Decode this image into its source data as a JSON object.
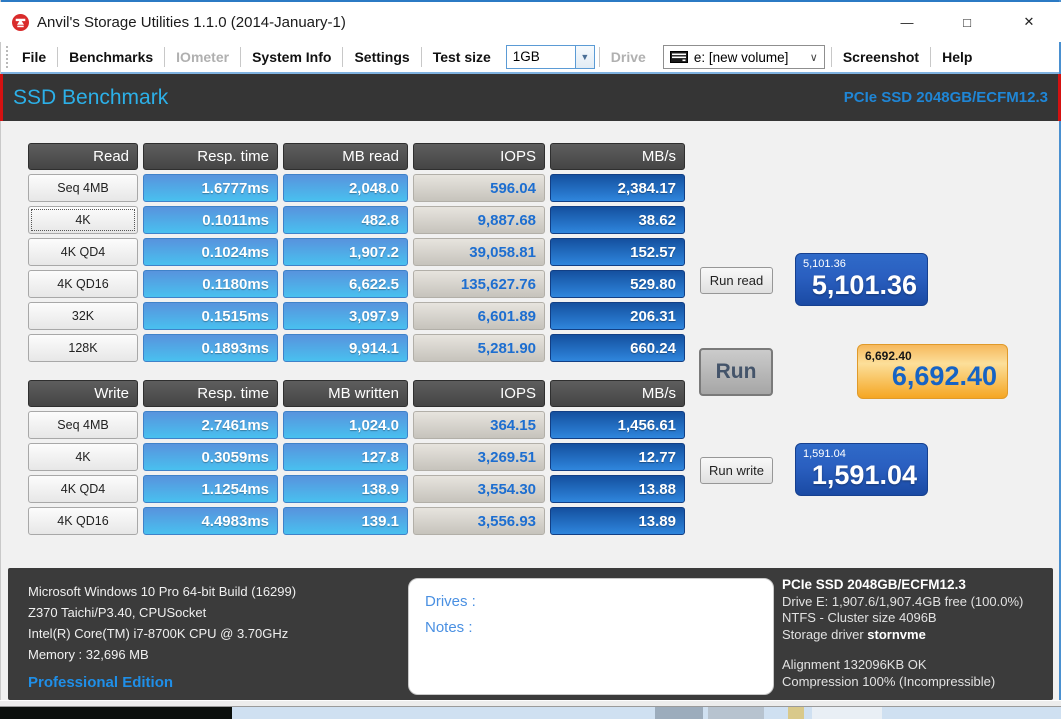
{
  "window": {
    "title": "Anvil's Storage Utilities 1.1.0 (2014-January-1)",
    "controls": {
      "minimize": "—",
      "maximize": "□",
      "close": "✕"
    }
  },
  "menu": {
    "file": "File",
    "benchmarks": "Benchmarks",
    "iometer": "IOmeter",
    "system_info": "System Info",
    "settings": "Settings",
    "test_size_label": "Test size",
    "test_size_value": "1GB",
    "drive_label": "Drive",
    "drive_value": "e: [new volume]",
    "screenshot": "Screenshot",
    "help": "Help"
  },
  "header": {
    "title": "SSD Benchmark",
    "device": "PCIe SSD 2048GB/ECFM12.3"
  },
  "read_table": {
    "headers": [
      "Read",
      "Resp. time",
      "MB read",
      "IOPS",
      "MB/s"
    ],
    "rows": [
      {
        "label": "Seq 4MB",
        "resp": "1.6777ms",
        "mb": "2,048.0",
        "iops": "596.04",
        "mbs": "2,384.17"
      },
      {
        "label": "4K",
        "resp": "0.1011ms",
        "mb": "482.8",
        "iops": "9,887.68",
        "mbs": "38.62"
      },
      {
        "label": "4K QD4",
        "resp": "0.1024ms",
        "mb": "1,907.2",
        "iops": "39,058.81",
        "mbs": "152.57"
      },
      {
        "label": "4K QD16",
        "resp": "0.1180ms",
        "mb": "6,622.5",
        "iops": "135,627.76",
        "mbs": "529.80"
      },
      {
        "label": "32K",
        "resp": "0.1515ms",
        "mb": "3,097.9",
        "iops": "6,601.89",
        "mbs": "206.31"
      },
      {
        "label": "128K",
        "resp": "0.1893ms",
        "mb": "9,914.1",
        "iops": "5,281.90",
        "mbs": "660.24"
      }
    ]
  },
  "write_table": {
    "headers": [
      "Write",
      "Resp. time",
      "MB written",
      "IOPS",
      "MB/s"
    ],
    "rows": [
      {
        "label": "Seq 4MB",
        "resp": "2.7461ms",
        "mb": "1,024.0",
        "iops": "364.15",
        "mbs": "1,456.61"
      },
      {
        "label": "4K",
        "resp": "0.3059ms",
        "mb": "127.8",
        "iops": "3,269.51",
        "mbs": "12.77"
      },
      {
        "label": "4K QD4",
        "resp": "1.1254ms",
        "mb": "138.9",
        "iops": "3,554.30",
        "mbs": "13.88"
      },
      {
        "label": "4K QD16",
        "resp": "4.4983ms",
        "mb": "139.1",
        "iops": "3,556.93",
        "mbs": "13.89"
      }
    ]
  },
  "actions": {
    "run_read": "Run read",
    "run": "Run",
    "run_write": "Run write"
  },
  "scores": {
    "read": {
      "small": "5,101.36",
      "large": "5,101.36"
    },
    "total": {
      "small": "6,692.40",
      "large": "6,692.40"
    },
    "write": {
      "small": "1,591.04",
      "large": "1,591.04"
    }
  },
  "footer": {
    "system": [
      "Microsoft Windows 10 Pro 64-bit Build (16299)",
      "Z370 Taichi/P3.40, CPUSocket",
      "Intel(R) Core(TM) i7-8700K CPU @ 3.70GHz",
      "Memory : 32,696 MB"
    ],
    "edition": "Professional Edition",
    "drives_label": "Drives :",
    "notes_label": "Notes :",
    "device_title": "PCIe SSD 2048GB/ECFM12.3",
    "drive_info": "Drive E: 1,907.6/1,907.4GB free (100.0%)",
    "fs_info": "NTFS - Cluster size 4096B",
    "driver_label": "Storage driver",
    "driver_value": "stornvme",
    "alignment": "Alignment 132096KB OK",
    "compression": "Compression 100% (Incompressible)"
  },
  "colors": {
    "band_red": "#d41111",
    "band_bg": "#353535",
    "accent_blue": "#2cb0e8",
    "score_blue": "#2a5fc0",
    "score_orange": "#f5a623"
  }
}
